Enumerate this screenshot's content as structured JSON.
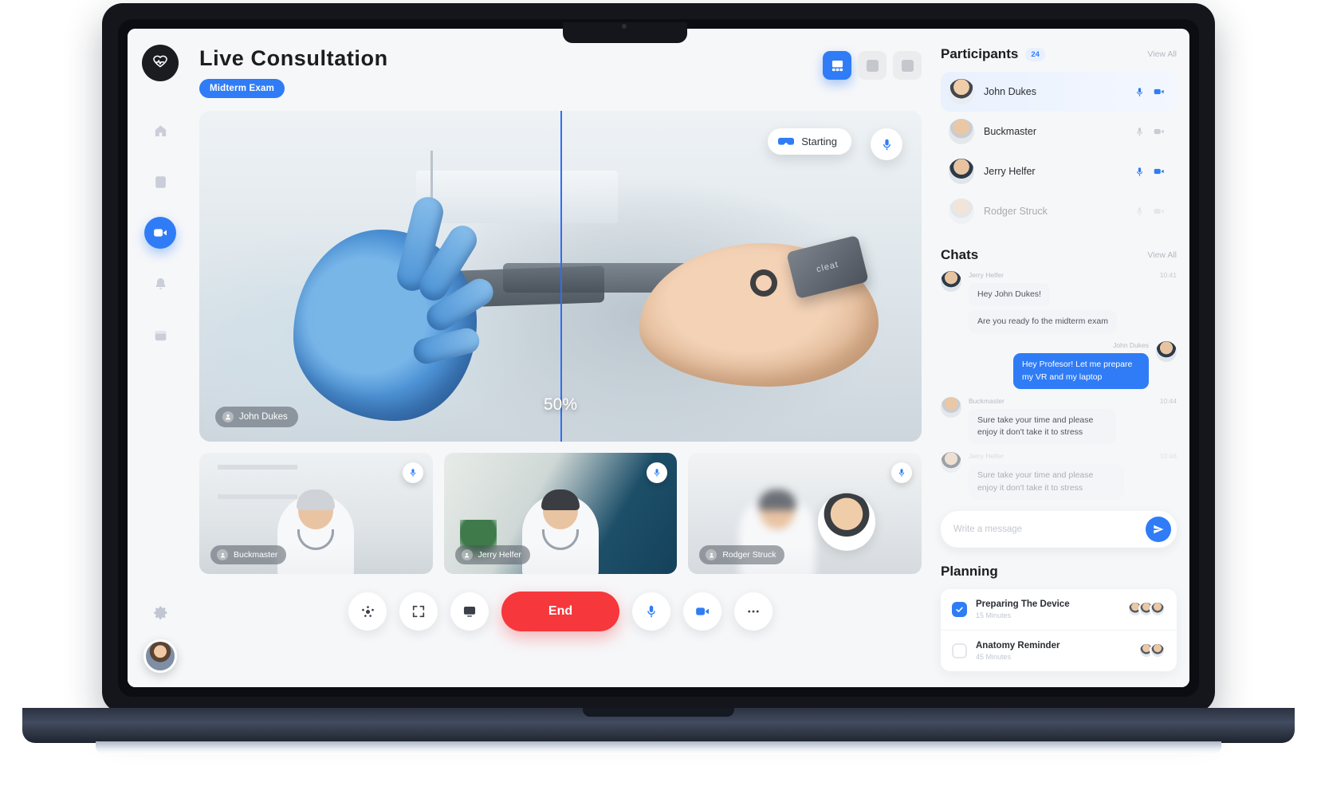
{
  "sidebar": {
    "logo_icon": "heart-pulse-icon",
    "items": [
      {
        "icon": "home-icon",
        "name": "home",
        "active": false
      },
      {
        "icon": "id-card-icon",
        "name": "patients",
        "active": false
      },
      {
        "icon": "video-camera-icon",
        "name": "consultation",
        "active": true
      },
      {
        "icon": "bell-icon",
        "name": "notifications",
        "active": false
      },
      {
        "icon": "calendar-icon",
        "name": "calendar",
        "active": false
      }
    ],
    "settings_icon": "gear-icon",
    "avatar": "user-avatar"
  },
  "header": {
    "title": "Live Consultation",
    "badge": "Midterm Exam",
    "view_toggle": [
      {
        "name": "grid-view",
        "icon": "grid-icon",
        "active": true
      },
      {
        "name": "split-view",
        "icon": "split-icon",
        "active": false
      },
      {
        "name": "single-view",
        "icon": "single-icon",
        "active": false
      }
    ]
  },
  "stage": {
    "status_label": "Starting",
    "status_icon": "vr-headset-icon",
    "mic_icon": "microphone-icon",
    "speaker_name": "John Dukes",
    "split_percent": "50%",
    "device_brand": "cleat"
  },
  "thumbnails": [
    {
      "name": "Buckmaster",
      "mic_icon": "microphone-icon"
    },
    {
      "name": "Jerry Helfer",
      "mic_icon": "microphone-icon"
    },
    {
      "name": "Rodger Struck",
      "mic_icon": "microphone-icon"
    }
  ],
  "controls": [
    {
      "name": "participants-button",
      "icon": "people-icon",
      "label": ""
    },
    {
      "name": "expand-button",
      "icon": "expand-icon",
      "label": ""
    },
    {
      "name": "share-screen-button",
      "icon": "upload-icon",
      "label": ""
    },
    {
      "name": "end-call-button",
      "icon": "",
      "label": "End"
    },
    {
      "name": "microphone-button",
      "icon": "microphone-icon",
      "label": ""
    },
    {
      "name": "camera-button",
      "icon": "video-camera-icon",
      "label": ""
    },
    {
      "name": "more-options-button",
      "icon": "ellipsis-icon",
      "label": ""
    }
  ],
  "participants": {
    "title": "Participants",
    "count": "24",
    "view_all": "View All",
    "list": [
      {
        "name": "John Dukes",
        "active": true,
        "muted": false,
        "mic_icon": "microphone-icon",
        "cam_icon": "video-camera-icon"
      },
      {
        "name": "Buckmaster",
        "active": false,
        "muted": true,
        "mic_icon": "microphone-icon",
        "cam_icon": "video-camera-icon"
      },
      {
        "name": "Jerry Helfer",
        "active": false,
        "muted": false,
        "mic_icon": "microphone-icon",
        "cam_icon": "video-camera-icon"
      },
      {
        "name": "Rodger Struck",
        "active": false,
        "muted": true,
        "offline": true,
        "mic_icon": "microphone-icon",
        "cam_icon": "video-camera-icon"
      }
    ]
  },
  "chats": {
    "title": "Chats",
    "view_all": "View All",
    "messages": [
      {
        "author": "Jerry Helfer",
        "time": "10:41",
        "outgoing": false,
        "faded": false,
        "texts": [
          "Hey John Dukes!",
          "Are you ready fo the midterm exam"
        ]
      },
      {
        "author": "John Dukes",
        "time": "",
        "outgoing": true,
        "faded": false,
        "texts": [
          "Hey Profesor! Let me prepare my VR and my laptop"
        ]
      },
      {
        "author": "Buckmaster",
        "time": "10:44",
        "outgoing": false,
        "faded": false,
        "texts": [
          "Sure take your time and please enjoy it don't take it to stress"
        ]
      },
      {
        "author": "Jerry Helfer",
        "time": "10:48",
        "outgoing": false,
        "faded": true,
        "texts": [
          "Sure take your time and please enjoy it don't take it to stress"
        ]
      }
    ],
    "composer_placeholder": "Write a message",
    "send_icon": "send-icon"
  },
  "planning": {
    "title": "Planning",
    "items": [
      {
        "name": "Preparing The Device",
        "duration": "15 Minutes",
        "checked": true,
        "avatars": 3
      },
      {
        "name": "Anatomy Reminder",
        "duration": "45 Minutes",
        "checked": false,
        "avatars": 2
      }
    ]
  },
  "colors": {
    "accent": "#2f7cf6",
    "danger": "#f6373b",
    "background": "#f6f7f9",
    "surface": "#ffffff"
  }
}
